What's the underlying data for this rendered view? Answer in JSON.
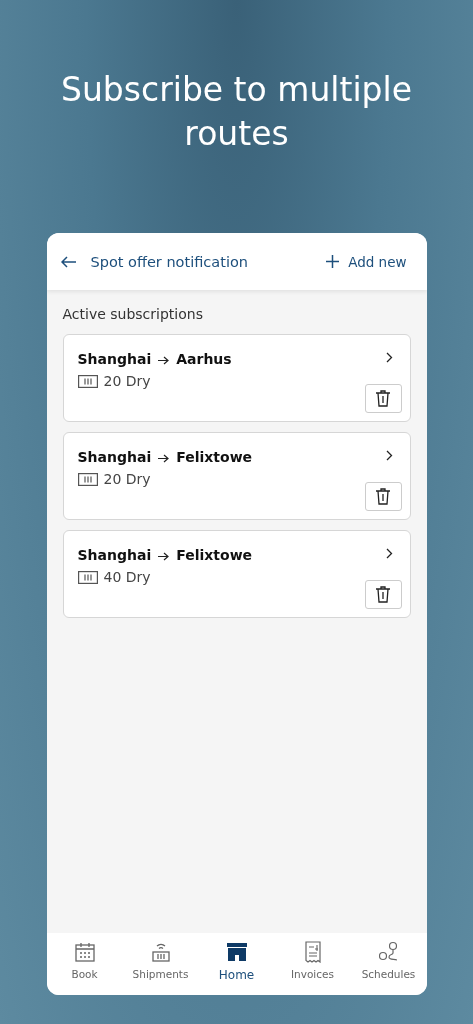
{
  "headline": "Subscribe to multiple routes",
  "header": {
    "title": "Spot offer notification",
    "action": "Add new"
  },
  "section_title": "Active subscriptions",
  "subscriptions": [
    {
      "origin": "Shanghai",
      "destination": "Aarhus",
      "container": "20 Dry"
    },
    {
      "origin": "Shanghai",
      "destination": "Felixtowe",
      "container": "20 Dry"
    },
    {
      "origin": "Shanghai",
      "destination": "Felixtowe",
      "container": "40 Dry"
    }
  ],
  "nav": [
    {
      "kind": "book",
      "label": "Book",
      "selected": false
    },
    {
      "kind": "shipments",
      "label": "Shipments",
      "selected": false
    },
    {
      "kind": "home",
      "label": "Home",
      "selected": true
    },
    {
      "kind": "invoices",
      "label": "Invoices",
      "selected": false
    },
    {
      "kind": "schedules",
      "label": "Schedules",
      "selected": false
    }
  ]
}
